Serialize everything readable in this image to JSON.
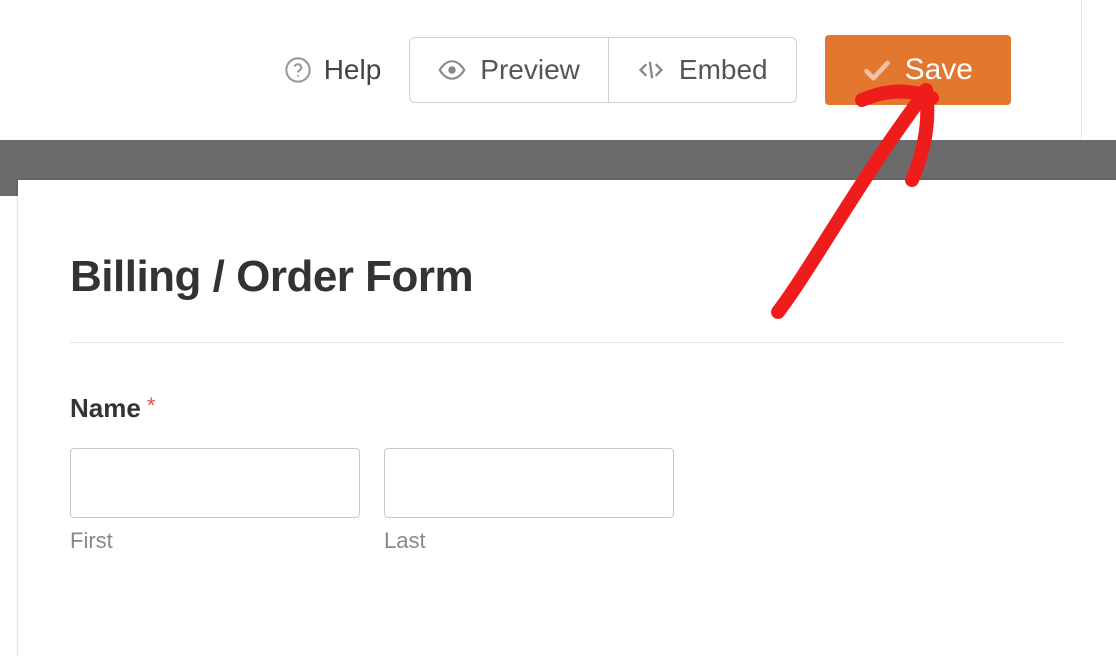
{
  "toolbar": {
    "help_label": "Help",
    "preview_label": "Preview",
    "embed_label": "Embed",
    "save_label": "Save"
  },
  "form": {
    "title": "Billing / Order Form",
    "name_field": {
      "label": "Name",
      "required_symbol": "*",
      "first_sublabel": "First",
      "last_sublabel": "Last"
    }
  }
}
